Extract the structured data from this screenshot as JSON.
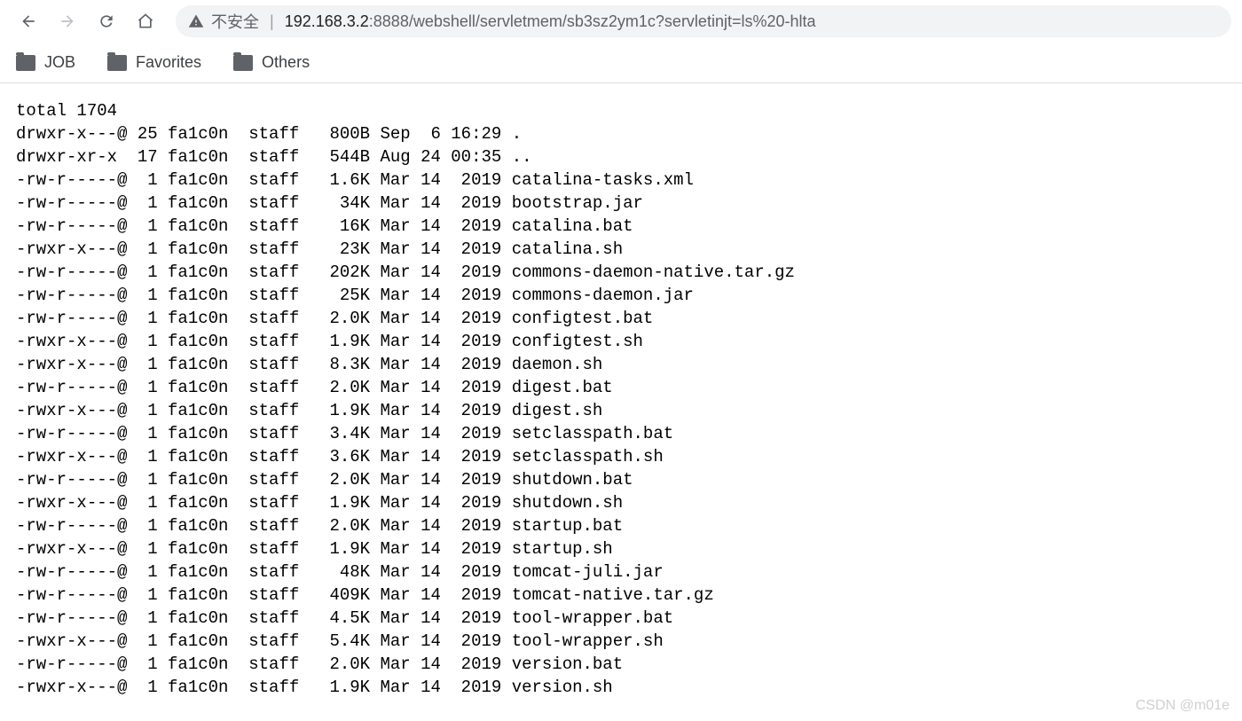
{
  "address": {
    "security_text": "不安全",
    "host": "192.168.3.2",
    "port_path": ":8888/webshell/servletmem/sb3sz2ym1c?servletinjt=ls%20-hlta"
  },
  "bookmarks": [
    {
      "label": "JOB"
    },
    {
      "label": "Favorites"
    },
    {
      "label": "Others"
    }
  ],
  "listing": {
    "total_line": "total 1704",
    "entries": [
      {
        "perm": "drwxr-x---@",
        "links": "25",
        "owner": "fa1c0n",
        "group": "staff",
        "size": "800B",
        "month": "Sep",
        "day": " 6",
        "time": "16:29",
        "name": "."
      },
      {
        "perm": "drwxr-xr-x ",
        "links": "17",
        "owner": "fa1c0n",
        "group": "staff",
        "size": "544B",
        "month": "Aug",
        "day": "24",
        "time": "00:35",
        "name": ".."
      },
      {
        "perm": "-rw-r-----@",
        "links": " 1",
        "owner": "fa1c0n",
        "group": "staff",
        "size": "1.6K",
        "month": "Mar",
        "day": "14",
        "time": " 2019",
        "name": "catalina-tasks.xml"
      },
      {
        "perm": "-rw-r-----@",
        "links": " 1",
        "owner": "fa1c0n",
        "group": "staff",
        "size": " 34K",
        "month": "Mar",
        "day": "14",
        "time": " 2019",
        "name": "bootstrap.jar"
      },
      {
        "perm": "-rw-r-----@",
        "links": " 1",
        "owner": "fa1c0n",
        "group": "staff",
        "size": " 16K",
        "month": "Mar",
        "day": "14",
        "time": " 2019",
        "name": "catalina.bat"
      },
      {
        "perm": "-rwxr-x---@",
        "links": " 1",
        "owner": "fa1c0n",
        "group": "staff",
        "size": " 23K",
        "month": "Mar",
        "day": "14",
        "time": " 2019",
        "name": "catalina.sh"
      },
      {
        "perm": "-rw-r-----@",
        "links": " 1",
        "owner": "fa1c0n",
        "group": "staff",
        "size": "202K",
        "month": "Mar",
        "day": "14",
        "time": " 2019",
        "name": "commons-daemon-native.tar.gz"
      },
      {
        "perm": "-rw-r-----@",
        "links": " 1",
        "owner": "fa1c0n",
        "group": "staff",
        "size": " 25K",
        "month": "Mar",
        "day": "14",
        "time": " 2019",
        "name": "commons-daemon.jar"
      },
      {
        "perm": "-rw-r-----@",
        "links": " 1",
        "owner": "fa1c0n",
        "group": "staff",
        "size": "2.0K",
        "month": "Mar",
        "day": "14",
        "time": " 2019",
        "name": "configtest.bat"
      },
      {
        "perm": "-rwxr-x---@",
        "links": " 1",
        "owner": "fa1c0n",
        "group": "staff",
        "size": "1.9K",
        "month": "Mar",
        "day": "14",
        "time": " 2019",
        "name": "configtest.sh"
      },
      {
        "perm": "-rwxr-x---@",
        "links": " 1",
        "owner": "fa1c0n",
        "group": "staff",
        "size": "8.3K",
        "month": "Mar",
        "day": "14",
        "time": " 2019",
        "name": "daemon.sh"
      },
      {
        "perm": "-rw-r-----@",
        "links": " 1",
        "owner": "fa1c0n",
        "group": "staff",
        "size": "2.0K",
        "month": "Mar",
        "day": "14",
        "time": " 2019",
        "name": "digest.bat"
      },
      {
        "perm": "-rwxr-x---@",
        "links": " 1",
        "owner": "fa1c0n",
        "group": "staff",
        "size": "1.9K",
        "month": "Mar",
        "day": "14",
        "time": " 2019",
        "name": "digest.sh"
      },
      {
        "perm": "-rw-r-----@",
        "links": " 1",
        "owner": "fa1c0n",
        "group": "staff",
        "size": "3.4K",
        "month": "Mar",
        "day": "14",
        "time": " 2019",
        "name": "setclasspath.bat"
      },
      {
        "perm": "-rwxr-x---@",
        "links": " 1",
        "owner": "fa1c0n",
        "group": "staff",
        "size": "3.6K",
        "month": "Mar",
        "day": "14",
        "time": " 2019",
        "name": "setclasspath.sh"
      },
      {
        "perm": "-rw-r-----@",
        "links": " 1",
        "owner": "fa1c0n",
        "group": "staff",
        "size": "2.0K",
        "month": "Mar",
        "day": "14",
        "time": " 2019",
        "name": "shutdown.bat"
      },
      {
        "perm": "-rwxr-x---@",
        "links": " 1",
        "owner": "fa1c0n",
        "group": "staff",
        "size": "1.9K",
        "month": "Mar",
        "day": "14",
        "time": " 2019",
        "name": "shutdown.sh"
      },
      {
        "perm": "-rw-r-----@",
        "links": " 1",
        "owner": "fa1c0n",
        "group": "staff",
        "size": "2.0K",
        "month": "Mar",
        "day": "14",
        "time": " 2019",
        "name": "startup.bat"
      },
      {
        "perm": "-rwxr-x---@",
        "links": " 1",
        "owner": "fa1c0n",
        "group": "staff",
        "size": "1.9K",
        "month": "Mar",
        "day": "14",
        "time": " 2019",
        "name": "startup.sh"
      },
      {
        "perm": "-rw-r-----@",
        "links": " 1",
        "owner": "fa1c0n",
        "group": "staff",
        "size": " 48K",
        "month": "Mar",
        "day": "14",
        "time": " 2019",
        "name": "tomcat-juli.jar"
      },
      {
        "perm": "-rw-r-----@",
        "links": " 1",
        "owner": "fa1c0n",
        "group": "staff",
        "size": "409K",
        "month": "Mar",
        "day": "14",
        "time": " 2019",
        "name": "tomcat-native.tar.gz"
      },
      {
        "perm": "-rw-r-----@",
        "links": " 1",
        "owner": "fa1c0n",
        "group": "staff",
        "size": "4.5K",
        "month": "Mar",
        "day": "14",
        "time": " 2019",
        "name": "tool-wrapper.bat"
      },
      {
        "perm": "-rwxr-x---@",
        "links": " 1",
        "owner": "fa1c0n",
        "group": "staff",
        "size": "5.4K",
        "month": "Mar",
        "day": "14",
        "time": " 2019",
        "name": "tool-wrapper.sh"
      },
      {
        "perm": "-rw-r-----@",
        "links": " 1",
        "owner": "fa1c0n",
        "group": "staff",
        "size": "2.0K",
        "month": "Mar",
        "day": "14",
        "time": " 2019",
        "name": "version.bat"
      },
      {
        "perm": "-rwxr-x---@",
        "links": " 1",
        "owner": "fa1c0n",
        "group": "staff",
        "size": "1.9K",
        "month": "Mar",
        "day": "14",
        "time": " 2019",
        "name": "version.sh"
      }
    ]
  },
  "watermark": "CSDN @m01e"
}
